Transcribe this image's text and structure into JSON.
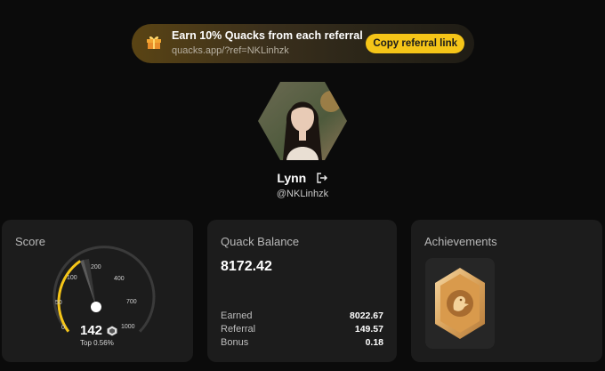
{
  "banner": {
    "title": "Earn 10% Quacks from each referral",
    "link": "quacks.app/?ref=NKLinhzk",
    "button": "Copy referral link",
    "icon": "gift-icon"
  },
  "profile": {
    "name": "Lynn",
    "handle": "@NKLinhzk",
    "avatar": "avatar-photo",
    "logout_icon": "logout-icon"
  },
  "score": {
    "title": "Score",
    "value": "142",
    "rank": "Top 0.56%",
    "icon": "cube-icon",
    "gauge_ticks": [
      "0",
      "50",
      "100",
      "200",
      "400",
      "700",
      "1000"
    ],
    "accent": "#f5c518"
  },
  "balance": {
    "title": "Quack Balance",
    "total": "8172.42",
    "rows": [
      {
        "label": "Earned",
        "value": "8022.67"
      },
      {
        "label": "Referral",
        "value": "149.57"
      },
      {
        "label": "Bonus",
        "value": "0.18"
      }
    ]
  },
  "achievements": {
    "title": "Achievements",
    "badges": [
      {
        "icon": "duck-badge-icon",
        "tier": "bronze"
      }
    ]
  }
}
